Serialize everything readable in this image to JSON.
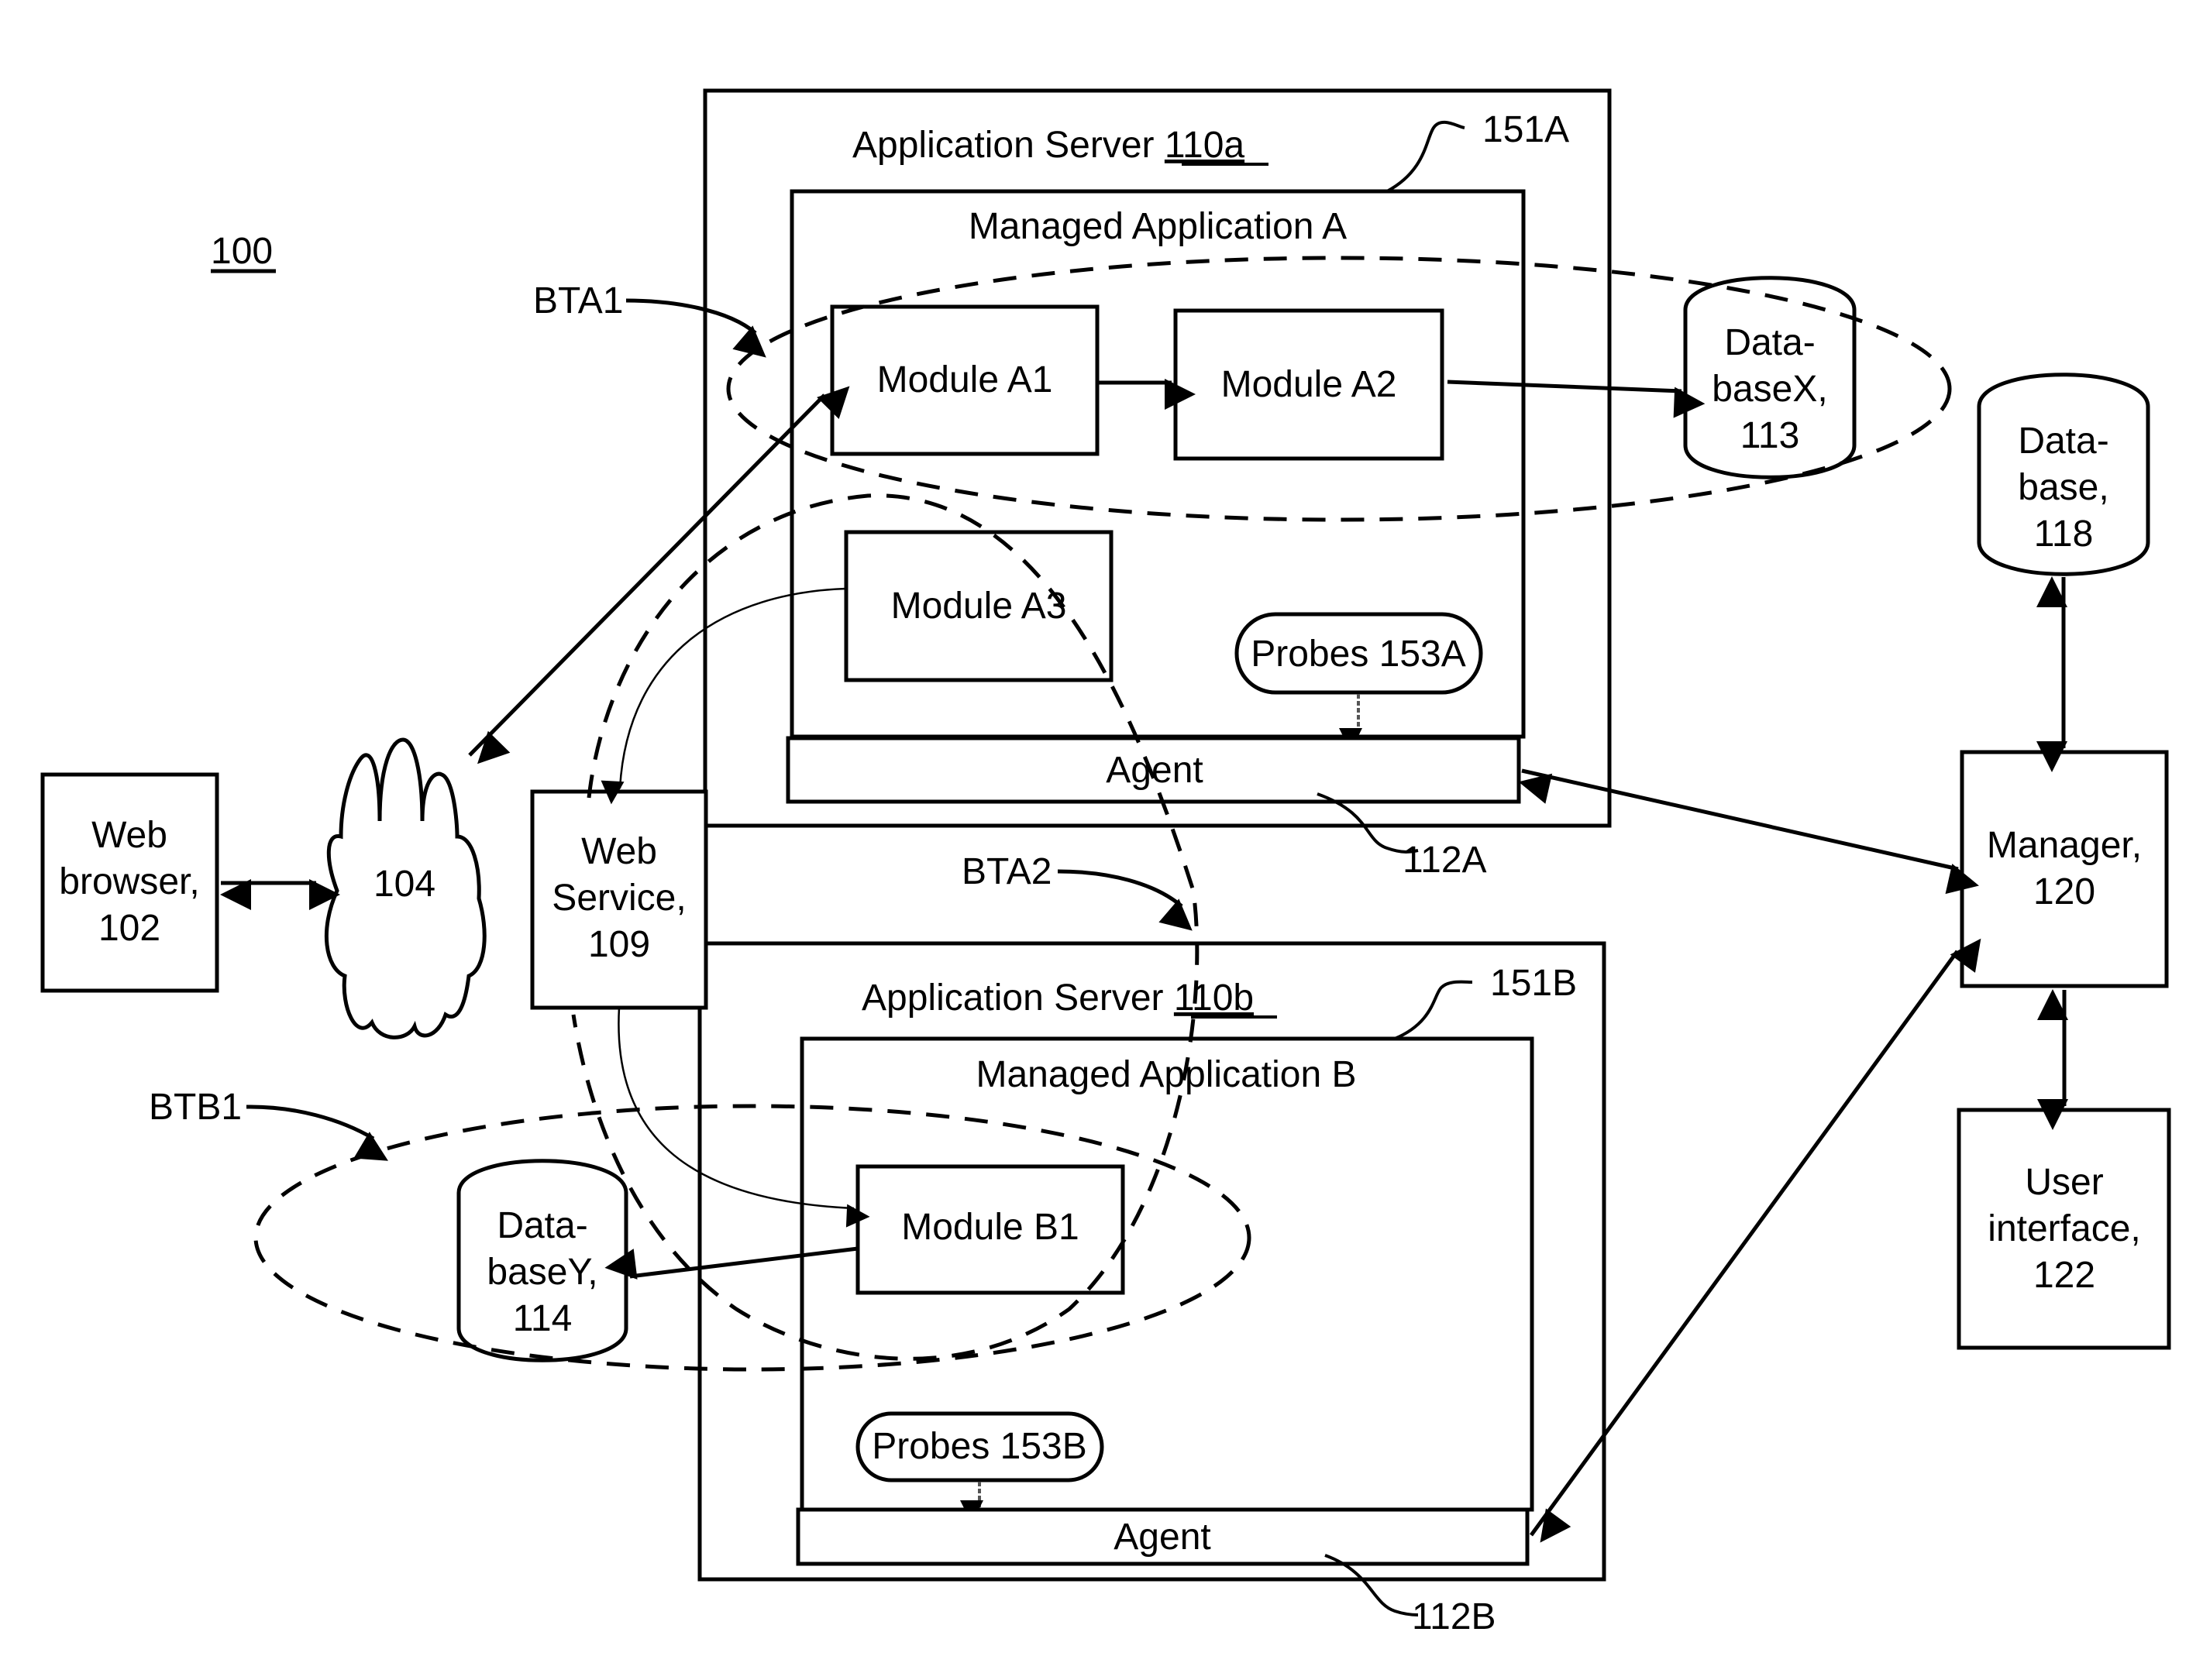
{
  "figure": {
    "ref": "100",
    "colors": {
      "ink": "#000000",
      "background": "#ffffff"
    }
  },
  "server_a": {
    "title": "Application Server ",
    "title_ref": "110a",
    "callout": "151A",
    "app_title": "Managed Application A",
    "modules": [
      "Module A1",
      "Module A2",
      "Module A3"
    ],
    "probes": "Probes 153A",
    "agent": "Agent",
    "agent_ref": "112A"
  },
  "server_b": {
    "title": "Application Server ",
    "title_ref": "110b",
    "callout": "151B",
    "app_title": "Managed Application B",
    "modules": [
      "Module B1"
    ],
    "probes": "Probes 153B",
    "agent": "Agent",
    "agent_ref": "112B"
  },
  "database_x": {
    "lines": [
      "Data-",
      "baseX,",
      "113"
    ]
  },
  "database_118": {
    "lines": [
      "Data-",
      "base,",
      "118"
    ]
  },
  "database_y": {
    "lines": [
      "Data-",
      "baseY,",
      "114"
    ]
  },
  "web_browser": {
    "lines": [
      "Web",
      "browser,",
      "102"
    ]
  },
  "network": {
    "label": "104"
  },
  "web_service": {
    "lines": [
      "Web",
      "Service,",
      "109"
    ]
  },
  "manager": {
    "lines": [
      "Manager,",
      "120"
    ]
  },
  "user_interface": {
    "lines": [
      "User",
      "interface,",
      "122"
    ]
  },
  "transactions": {
    "bta1": "BTA1",
    "bta2": "BTA2",
    "btb1": "BTB1"
  }
}
